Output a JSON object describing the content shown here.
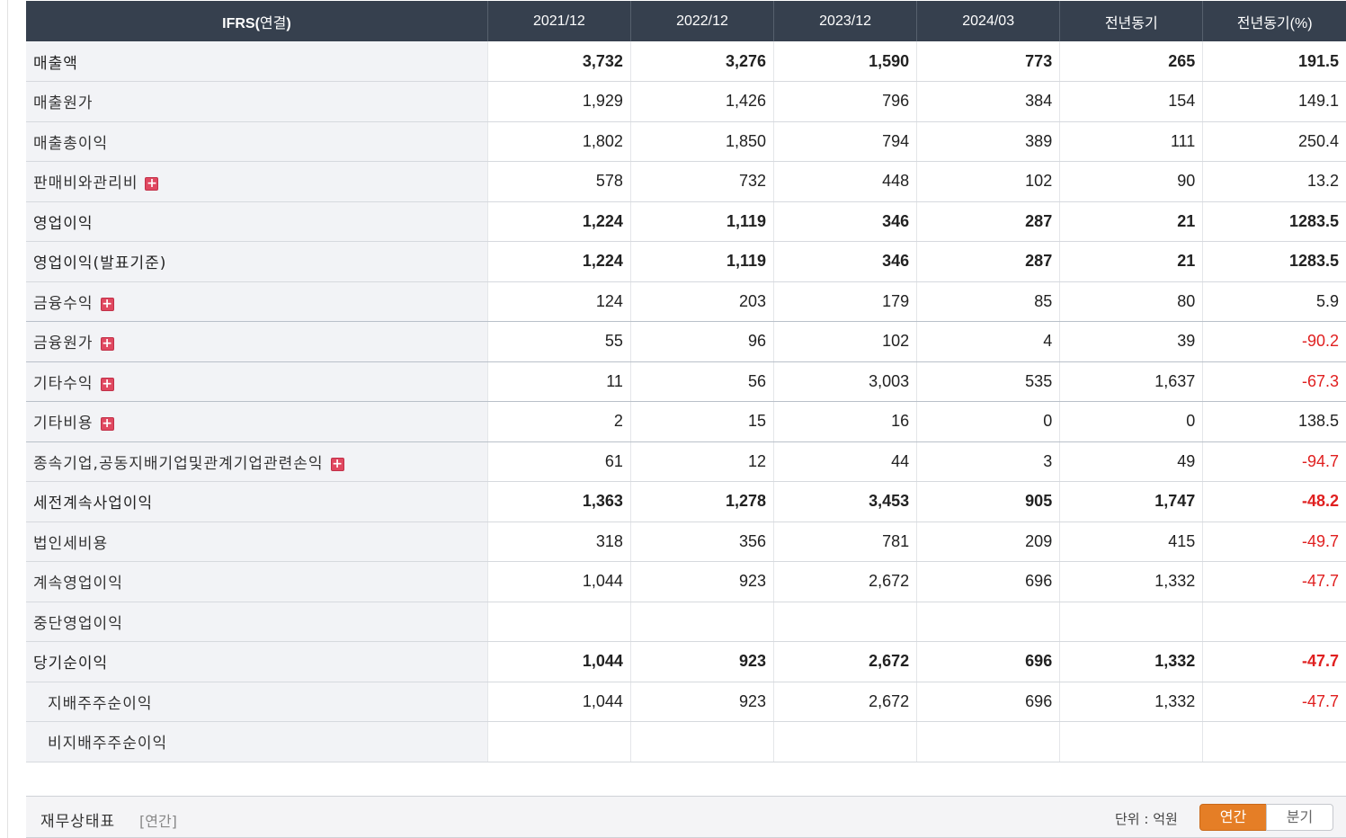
{
  "table": {
    "header_label_latin": "IFRS(",
    "header_label_kr": "연결",
    "header_label_close": ")",
    "columns": [
      "2021/12",
      "2022/12",
      "2023/12",
      "2024/03",
      "전년동기",
      "전년동기(%)"
    ],
    "rows": [
      {
        "label": "매출액",
        "bold": true,
        "plus": false,
        "sub": false,
        "values": [
          "3,732",
          "3,276",
          "1,590",
          "773",
          "265",
          "191.5"
        ],
        "neg": [
          false,
          false,
          false,
          false,
          false,
          false
        ]
      },
      {
        "label": "매출원가",
        "bold": false,
        "plus": false,
        "sub": false,
        "values": [
          "1,929",
          "1,426",
          "796",
          "384",
          "154",
          "149.1"
        ],
        "neg": [
          false,
          false,
          false,
          false,
          false,
          false
        ]
      },
      {
        "label": "매출총이익",
        "bold": false,
        "plus": false,
        "sub": false,
        "values": [
          "1,802",
          "1,850",
          "794",
          "389",
          "111",
          "250.4"
        ],
        "neg": [
          false,
          false,
          false,
          false,
          false,
          false
        ]
      },
      {
        "label": "판매비와관리비",
        "bold": false,
        "plus": true,
        "sub": false,
        "values": [
          "578",
          "732",
          "448",
          "102",
          "90",
          "13.2"
        ],
        "neg": [
          false,
          false,
          false,
          false,
          false,
          false
        ]
      },
      {
        "label": "영업이익",
        "bold": true,
        "plus": false,
        "sub": false,
        "values": [
          "1,224",
          "1,119",
          "346",
          "287",
          "21",
          "1283.5"
        ],
        "neg": [
          false,
          false,
          false,
          false,
          false,
          false
        ]
      },
      {
        "label": "영업이익(발표기준)",
        "bold": true,
        "plus": false,
        "sub": false,
        "values": [
          "1,224",
          "1,119",
          "346",
          "287",
          "21",
          "1283.5"
        ],
        "neg": [
          false,
          false,
          false,
          false,
          false,
          false
        ]
      },
      {
        "label": "금융수익",
        "bold": false,
        "plus": true,
        "sub": false,
        "values": [
          "124",
          "203",
          "179",
          "85",
          "80",
          "5.9"
        ],
        "neg": [
          false,
          false,
          false,
          false,
          false,
          false
        ]
      },
      {
        "label": "금융원가",
        "bold": false,
        "plus": true,
        "sub": false,
        "values": [
          "55",
          "96",
          "102",
          "4",
          "39",
          "-90.2"
        ],
        "neg": [
          false,
          false,
          false,
          false,
          false,
          true
        ]
      },
      {
        "label": "기타수익",
        "bold": false,
        "plus": true,
        "sub": false,
        "values": [
          "11",
          "56",
          "3,003",
          "535",
          "1,637",
          "-67.3"
        ],
        "neg": [
          false,
          false,
          false,
          false,
          false,
          true
        ]
      },
      {
        "label": "기타비용",
        "bold": false,
        "plus": true,
        "sub": false,
        "values": [
          "2",
          "15",
          "16",
          "0",
          "0",
          "138.5"
        ],
        "neg": [
          false,
          false,
          false,
          false,
          false,
          false
        ]
      },
      {
        "label": "종속기업,공동지배기업및관계기업관련손익",
        "bold": false,
        "plus": true,
        "sub": false,
        "values": [
          "61",
          "12",
          "44",
          "3",
          "49",
          "-94.7"
        ],
        "neg": [
          false,
          false,
          false,
          false,
          false,
          true
        ]
      },
      {
        "label": "세전계속사업이익",
        "bold": true,
        "plus": false,
        "sub": false,
        "values": [
          "1,363",
          "1,278",
          "3,453",
          "905",
          "1,747",
          "-48.2"
        ],
        "neg": [
          false,
          false,
          false,
          false,
          false,
          true
        ]
      },
      {
        "label": "법인세비용",
        "bold": false,
        "plus": false,
        "sub": false,
        "values": [
          "318",
          "356",
          "781",
          "209",
          "415",
          "-49.7"
        ],
        "neg": [
          false,
          false,
          false,
          false,
          false,
          true
        ]
      },
      {
        "label": "계속영업이익",
        "bold": false,
        "plus": false,
        "sub": false,
        "values": [
          "1,044",
          "923",
          "2,672",
          "696",
          "1,332",
          "-47.7"
        ],
        "neg": [
          false,
          false,
          false,
          false,
          false,
          true
        ]
      },
      {
        "label": "중단영업이익",
        "bold": false,
        "plus": false,
        "sub": false,
        "values": [
          "",
          "",
          "",
          "",
          "",
          ""
        ],
        "neg": [
          false,
          false,
          false,
          false,
          false,
          false
        ]
      },
      {
        "label": "당기순이익",
        "bold": true,
        "plus": false,
        "sub": false,
        "values": [
          "1,044",
          "923",
          "2,672",
          "696",
          "1,332",
          "-47.7"
        ],
        "neg": [
          false,
          false,
          false,
          false,
          false,
          true
        ]
      },
      {
        "label": "지배주주순이익",
        "bold": false,
        "plus": false,
        "sub": true,
        "values": [
          "1,044",
          "923",
          "2,672",
          "696",
          "1,332",
          "-47.7"
        ],
        "neg": [
          false,
          false,
          false,
          false,
          false,
          true
        ]
      },
      {
        "label": "비지배주주순이익",
        "bold": false,
        "plus": false,
        "sub": true,
        "values": [
          "",
          "",
          "",
          "",
          "",
          ""
        ],
        "neg": [
          false,
          false,
          false,
          false,
          false,
          false
        ]
      }
    ]
  },
  "bottom_bar": {
    "title": "재무상태표",
    "period": "[연간]",
    "unit": "단위 : 억원",
    "annual_label": "연간",
    "quarter_label": "분기"
  },
  "colors": {
    "header_bg": "#36404e",
    "negative": "#e02020",
    "toggle_active": "#e57e26",
    "plus_icon": "#e04860"
  }
}
